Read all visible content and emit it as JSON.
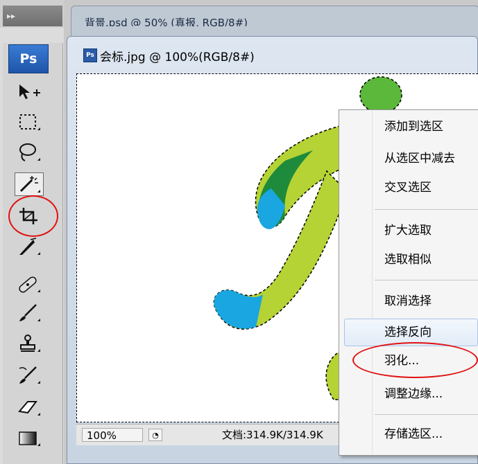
{
  "app": {
    "logo_label": "Ps"
  },
  "background_document": {
    "title": "背景.psd @ 50% (真报, RGB/8#)"
  },
  "document": {
    "title": "会标.jpg @ 100%(RGB/8#)",
    "zoom": "100%",
    "doc_info": "文档:314.9K/314.9K"
  },
  "tools": [
    {
      "name": "move-tool-icon"
    },
    {
      "name": "marquee-tool-icon"
    },
    {
      "name": "lasso-tool-icon"
    },
    {
      "name": "magic-wand-tool-icon"
    },
    {
      "name": "crop-tool-icon"
    },
    {
      "name": "slice-tool-icon"
    },
    {
      "name": "healing-brush-tool-icon"
    },
    {
      "name": "brush-tool-icon"
    },
    {
      "name": "clone-stamp-tool-icon"
    },
    {
      "name": "history-brush-tool-icon"
    },
    {
      "name": "eraser-tool-icon"
    },
    {
      "name": "gradient-tool-icon"
    }
  ],
  "context_menu": {
    "items": [
      {
        "label": "添加到选区"
      },
      {
        "label": "从选区中减去"
      },
      {
        "label": "交叉选区"
      },
      {
        "label": "扩大选取"
      },
      {
        "label": "选取相似"
      },
      {
        "label": "取消选择"
      },
      {
        "label": "选择反向"
      },
      {
        "label": "羽化..."
      },
      {
        "label": "调整边缘..."
      },
      {
        "label": "存储选区..."
      }
    ],
    "highlighted": "选择反向"
  },
  "colors": {
    "annotation_red": "#e01010",
    "logo_green_light": "#b5d334",
    "logo_green_dark": "#1e8a3c",
    "logo_blue": "#1aa6e0",
    "logo_green_dot": "#5bb83a"
  }
}
